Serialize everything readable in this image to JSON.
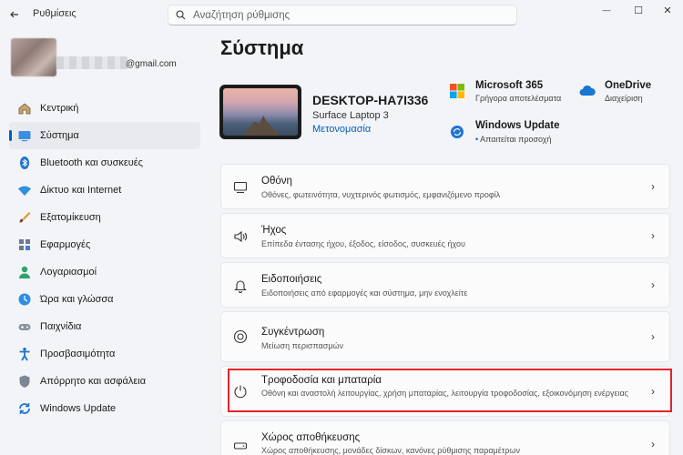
{
  "app": {
    "title": "Ρυθμίσεις",
    "back_icon": "back-arrow-icon",
    "window_controls": {
      "minimize": "—",
      "maximize": "☐",
      "close": "✕"
    }
  },
  "search": {
    "placeholder": "Αναζήτηση ρύθμισης"
  },
  "profile": {
    "email_suffix": "@gmail.com"
  },
  "sidebar": {
    "items": [
      {
        "label": "Κεντρική",
        "icon": "home-icon"
      },
      {
        "label": "Σύστημα",
        "icon": "system-icon",
        "active": true
      },
      {
        "label": "Bluetooth και συσκευές",
        "icon": "bluetooth-icon"
      },
      {
        "label": "Δίκτυο και Internet",
        "icon": "wifi-icon"
      },
      {
        "label": "Εξατομίκευση",
        "icon": "brush-icon"
      },
      {
        "label": "Εφαρμογές",
        "icon": "apps-icon"
      },
      {
        "label": "Λογαριασμοί",
        "icon": "account-icon"
      },
      {
        "label": "Ώρα και γλώσσα",
        "icon": "time-language-icon"
      },
      {
        "label": "Παιχνίδια",
        "icon": "gamepad-icon"
      },
      {
        "label": "Προσβασιμότητα",
        "icon": "accessibility-icon"
      },
      {
        "label": "Απόρρητο και ασφάλεια",
        "icon": "shield-icon"
      },
      {
        "label": "Windows Update",
        "icon": "windows-update-icon"
      }
    ]
  },
  "main": {
    "title": "Σύστημα",
    "device": {
      "name": "DESKTOP-HA7I336",
      "model": "Surface Laptop 3",
      "rename": "Μετονομασία"
    },
    "tiles": [
      {
        "title": "Microsoft 365",
        "subtitle": "Γρήγορα αποτελέσματα",
        "icon": "microsoft365-icon"
      },
      {
        "title": "OneDrive",
        "subtitle": "Διαχείριση",
        "icon": "onedrive-icon"
      },
      {
        "title": "Windows Update",
        "subtitle": "Απαιτείται προσοχή",
        "icon": "windows-update-icon"
      }
    ],
    "cards": [
      {
        "title": "Οθόνη",
        "subtitle": "Οθόνες, φωτεινότητα, νυχτερινός φωτισμός, εμφανιζόμενο προφίλ",
        "icon": "monitor-icon"
      },
      {
        "title": "Ήχος",
        "subtitle": "Επίπεδα έντασης ήχου, έξοδος, είσοδος, συσκευές ήχου",
        "icon": "speaker-icon"
      },
      {
        "title": "Ειδοποιήσεις",
        "subtitle": "Ειδοποιήσεις από εφαρμογές και σύστημα, μην ενοχλείτε",
        "icon": "bell-icon"
      },
      {
        "title": "Συγκέντρωση",
        "subtitle": "Μείωση περισπασμών",
        "icon": "focus-icon"
      },
      {
        "title": "Τροφοδοσία και μπαταρία",
        "subtitle": "Οθόνη και αναστολή λειτουργίας, χρήση μπαταρίας, λειτουργία τροφοδοσίας, εξοικονόμηση ενέργειας",
        "icon": "power-icon"
      },
      {
        "title": "Χώρος αποθήκευσης",
        "subtitle": "Χώρος αποθήκευσης, μονάδες δίσκων, κανόνες ρύθμισης παραμέτρων",
        "icon": "storage-icon"
      }
    ]
  },
  "colors": {
    "accent": "#005fb8",
    "highlight": "#e8232a",
    "background": "#f3f4f8",
    "card": "#fbfbfc"
  }
}
